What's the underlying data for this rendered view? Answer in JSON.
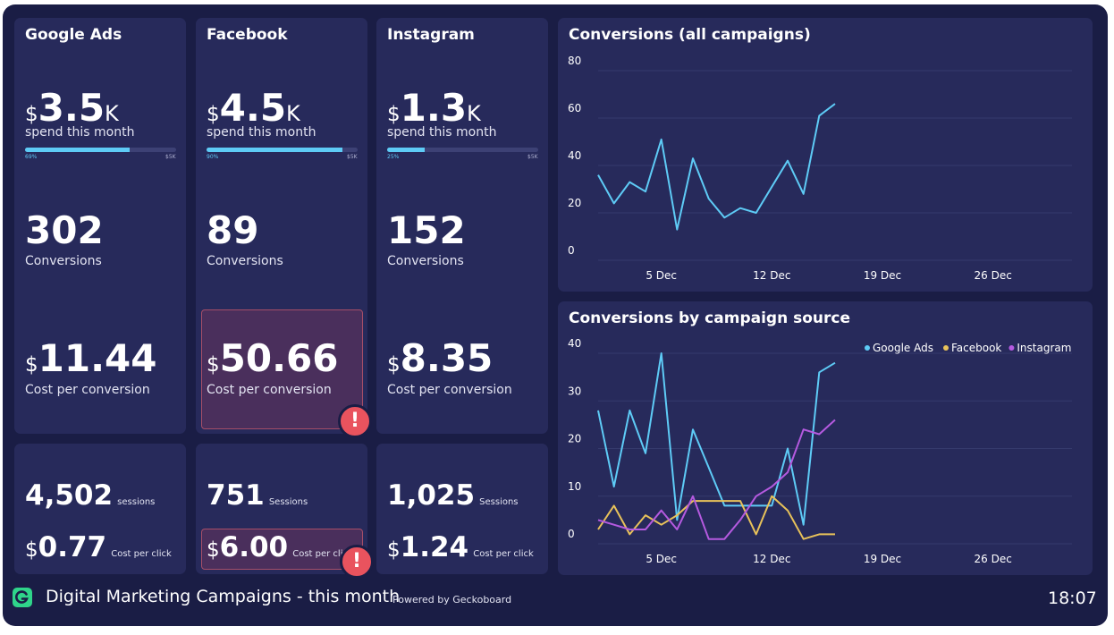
{
  "cards": [
    {
      "title": "Google Ads",
      "spend": "3.5",
      "spend_suffix": "K",
      "spend_label": "spend this month",
      "progress": 0.69,
      "progress_label": "69%",
      "progress_max": "$5K",
      "conversions": "302",
      "conversions_label": "Conversions",
      "cpc": "11.44",
      "cpc_label": "Cost per conversion",
      "sessions": "4,502",
      "sessions_label": "sessions",
      "click_cost": "0.77",
      "click_label": "Cost per click"
    },
    {
      "title": "Facebook",
      "spend": "4.5",
      "spend_suffix": "K",
      "spend_label": "spend this month",
      "progress": 0.9,
      "progress_label": "90%",
      "progress_max": "$5K",
      "conversions": "89",
      "conversions_label": "Conversions",
      "cpc": "50.66",
      "cpc_label": "Cost per conversion",
      "sessions": "751",
      "sessions_label": "Sessions",
      "click_cost": "6.00",
      "click_label": "Cost per click"
    },
    {
      "title": "Instagram",
      "spend": "1.3",
      "spend_suffix": "K",
      "spend_label": "spend this month",
      "progress": 0.25,
      "progress_label": "25%",
      "progress_max": "$5K",
      "conversions": "152",
      "conversions_label": "Conversions",
      "cpc": "8.35",
      "cpc_label": "Cost per conversion",
      "sessions": "1,025",
      "sessions_label": "Sessions",
      "click_cost": "1.24",
      "click_label": "Cost per click"
    }
  ],
  "currency": "$",
  "alert_icon": "!",
  "colors": {
    "background": "#1a1d45",
    "card": "#272a5b",
    "google": "#5ecbf6",
    "facebook": "#e8c25a",
    "instagram": "#b55ae0",
    "alert": "#e9535e"
  },
  "footer": {
    "title": "Digital Marketing Campaigns - this month",
    "powered": "Powered by",
    "brand": "Geckoboard",
    "time": "18:07",
    "logo_icon": "geckoboard-logo-icon"
  },
  "chart_data": [
    {
      "type": "line",
      "title": "Conversions (all campaigns)",
      "x_ticks": [
        "5 Dec",
        "12 Dec",
        "19 Dec",
        "26 Dec"
      ],
      "y_ticks": [
        "0",
        "20",
        "40",
        "60",
        "80"
      ],
      "ylim": [
        0,
        80
      ],
      "xlim": [
        1,
        31
      ],
      "grid": true,
      "series": [
        {
          "color": "#5ecbf6",
          "x": [
            1,
            2,
            3,
            4,
            5,
            6,
            7,
            8,
            9,
            10,
            11,
            12,
            13,
            14,
            15,
            16
          ],
          "values": [
            36,
            24,
            33,
            29,
            51,
            13,
            43,
            26,
            18,
            22,
            20,
            31,
            42,
            28,
            61,
            66
          ]
        }
      ]
    },
    {
      "type": "line",
      "title": "Conversions by campaign source",
      "x_ticks": [
        "5 Dec",
        "12 Dec",
        "19 Dec",
        "26 Dec"
      ],
      "y_ticks": [
        "0",
        "10",
        "20",
        "30",
        "40"
      ],
      "ylim": [
        0,
        40
      ],
      "xlim": [
        1,
        31
      ],
      "grid": true,
      "legend_position": "top-right",
      "series": [
        {
          "name": "Google Ads",
          "color": "#5ecbf6",
          "x": [
            1,
            2,
            3,
            4,
            5,
            6,
            7,
            8,
            9,
            10,
            11,
            12,
            13,
            14,
            15,
            16
          ],
          "values": [
            28,
            12,
            28,
            19,
            40,
            5,
            24,
            16,
            8,
            8,
            8,
            8,
            20,
            4,
            36,
            38
          ]
        },
        {
          "name": "Facebook",
          "color": "#e8c25a",
          "x": [
            1,
            2,
            3,
            4,
            5,
            6,
            7,
            8,
            9,
            10,
            11,
            12,
            13,
            14,
            15,
            16
          ],
          "values": [
            3,
            8,
            2,
            6,
            4,
            6,
            9,
            9,
            9,
            9,
            2,
            10,
            7,
            1,
            2,
            2
          ]
        },
        {
          "name": "Instagram",
          "color": "#b55ae0",
          "x": [
            1,
            2,
            3,
            4,
            5,
            6,
            7,
            8,
            9,
            10,
            11,
            12,
            13,
            14,
            15,
            16
          ],
          "values": [
            5,
            4,
            3,
            3,
            7,
            3,
            10,
            1,
            1,
            5,
            10,
            12,
            15,
            24,
            23,
            26
          ]
        }
      ]
    }
  ]
}
